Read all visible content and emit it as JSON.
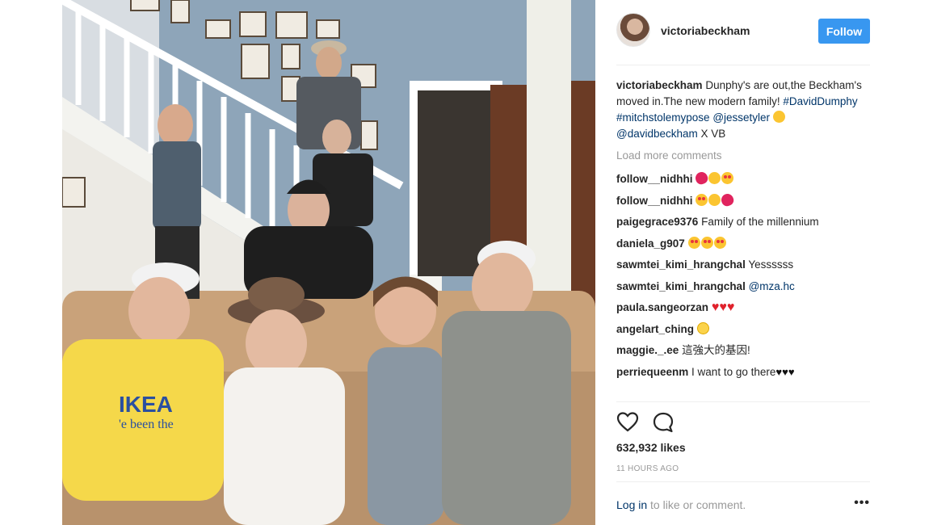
{
  "post": {
    "username": "victoriabeckham",
    "follow_label": "Follow",
    "caption": {
      "username": "victoriabeckham",
      "text": " Dunphy's are out,the Beckham's moved in.The new modern family! ",
      "tag1": "#DavidDumphy",
      "tag2": "#mitchstolemypose",
      "mention1": "@jessetyler",
      "mention2": "@davidbeckham",
      "suffix": " X VB"
    },
    "load_more": "Load more comments",
    "comments": [
      {
        "user": "follow__nidhhi",
        "text": ""
      },
      {
        "user": "follow__nidhhi",
        "text": ""
      },
      {
        "user": "paigegrace9376",
        "text": "Family of the millennium"
      },
      {
        "user": "daniela_g907",
        "text": ""
      },
      {
        "user": "sawmtei_kimi_hrangchal",
        "text": "Yessssss"
      },
      {
        "user": "sawmtei_kimi_hrangchal",
        "text": "@mza.hc"
      },
      {
        "user": "paula.sangeorzan",
        "text": ""
      },
      {
        "user": "angelart_ching",
        "text": ""
      },
      {
        "user": "maggie._.ee",
        "text": "這強大的基因!"
      },
      {
        "user": "perriequeenm",
        "text": "I want to go there"
      }
    ],
    "likes": "632,932 likes",
    "time": "11 HOURS AGO",
    "login_link": "Log in",
    "login_suffix": " to like or comment.",
    "more_label": "•••"
  },
  "icons": {
    "like": "heart-outline-icon",
    "comment": "comment-bubble-icon",
    "options": "more-options-icon"
  },
  "colors": {
    "follow_button": "#3897f0",
    "link": "#003569",
    "muted": "#999999",
    "text": "#262626"
  },
  "image": {
    "shirt_text_1": "IKEA",
    "shirt_text_2": "'e been the"
  }
}
